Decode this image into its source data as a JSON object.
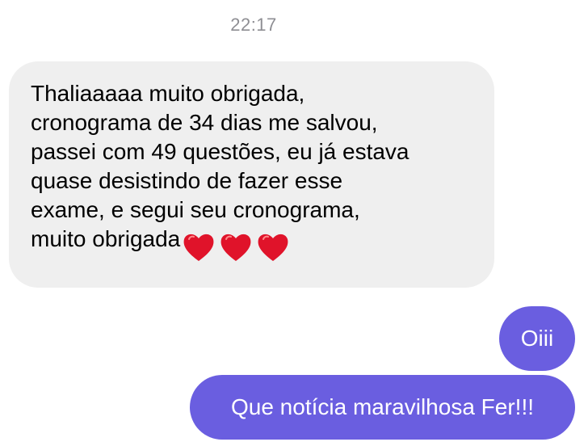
{
  "conversation": {
    "timestamp": "22:17",
    "incoming": {
      "lines": [
        "Thaliaaaaa muito obrigada,",
        "cronograma de 34 dias me salvou,",
        "passei com 49 questões, eu já estava",
        "quase desistindo de fazer esse",
        "exame, e segui seu cronograma,",
        "muito obrigada"
      ],
      "trailing_emoji": [
        "red-heart-icon",
        "red-heart-icon",
        "red-heart-icon"
      ]
    },
    "outgoing": [
      {
        "text": "Oiii"
      },
      {
        "text": "Que notícia maravilhosa Fer!!!"
      }
    ]
  },
  "colors": {
    "incoming_bubble": "#efefef",
    "outgoing_bubble": "#6a5ee0",
    "timestamp": "#8e8e93",
    "heart": "#e0132a"
  }
}
